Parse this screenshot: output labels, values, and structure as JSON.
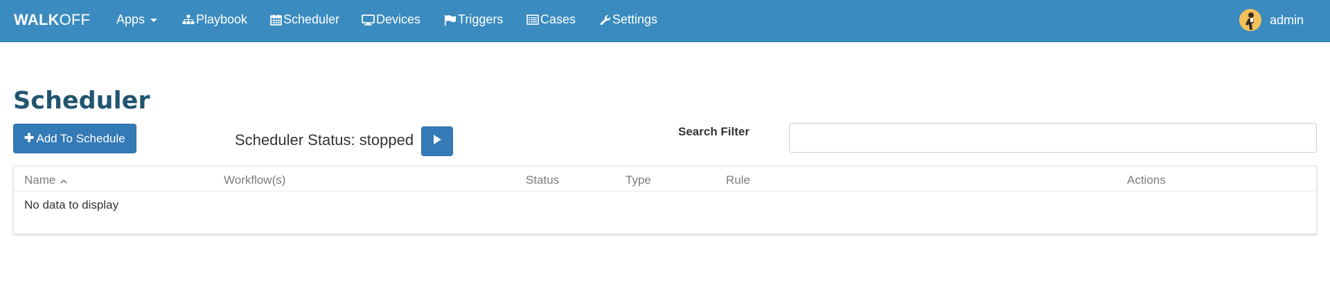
{
  "navbar": {
    "brand_bold": "WALK",
    "brand_light": "OFF",
    "items": [
      {
        "label": "Apps",
        "icon": "caret-down-icon"
      },
      {
        "label": "Playbook",
        "icon": "sitemap-icon"
      },
      {
        "label": "Scheduler",
        "icon": "calendar-icon"
      },
      {
        "label": "Devices",
        "icon": "monitor-icon"
      },
      {
        "label": "Triggers",
        "icon": "flag-icon"
      },
      {
        "label": "Cases",
        "icon": "list-alt-icon"
      },
      {
        "label": "Settings",
        "icon": "wrench-icon"
      }
    ],
    "user": {
      "name": "admin",
      "icon": "avatar-icon"
    }
  },
  "page": {
    "title": "Scheduler",
    "add_button_label": "Add To Schedule",
    "status_text": "Scheduler Status: stopped",
    "play_button_icon": "play-icon",
    "search_label": "Search Filter",
    "search_value": "",
    "search_placeholder": ""
  },
  "table": {
    "columns": [
      {
        "label": "Name",
        "sort": "ascending"
      },
      {
        "label": "Workflow(s)"
      },
      {
        "label": "Status"
      },
      {
        "label": "Type"
      },
      {
        "label": "Rule"
      },
      {
        "label": "Actions"
      }
    ],
    "rows": [],
    "empty_message": "No data to display"
  },
  "colors": {
    "navbar_bg": "#3a8bbf",
    "button_primary": "#337ab7",
    "title_color": "#22556f"
  }
}
